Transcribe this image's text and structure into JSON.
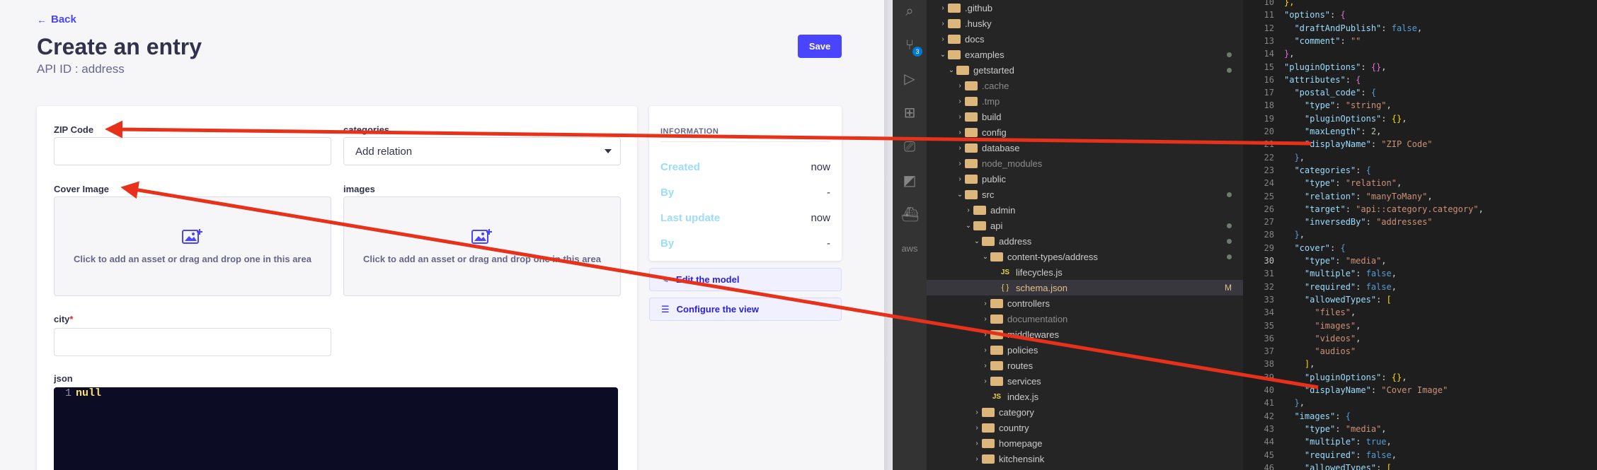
{
  "strapi": {
    "back_label": "Back",
    "title": "Create an entry",
    "api_id": "API ID : address",
    "save_label": "Save",
    "fields": {
      "zip_label": "ZIP Code",
      "categories_label": "categories",
      "categories_placeholder": "Add relation",
      "cover_label": "Cover Image",
      "images_label": "images",
      "dropzone_text": "Click to add an asset or drag and drop one in this area",
      "city_label": "city",
      "city_required_mark": "*",
      "json_label": "json",
      "json_line_number": "1",
      "json_value": "null"
    },
    "information": {
      "title": "INFORMATION",
      "rows": [
        {
          "key": "Created",
          "value": "now"
        },
        {
          "key": "By",
          "value": "-"
        },
        {
          "key": "Last update",
          "value": "now"
        },
        {
          "key": "By",
          "value": "-"
        }
      ]
    },
    "edit_model_label": "Edit the model",
    "configure_view_label": "Configure the view",
    "accent_color": "#4945ff"
  },
  "vscode": {
    "source_control_badge": "3",
    "explorer": [
      {
        "label": ".github",
        "type": "folder",
        "open": false,
        "depth": 0
      },
      {
        "label": ".husky",
        "type": "folder",
        "open": false,
        "depth": 0
      },
      {
        "label": "docs",
        "type": "folder",
        "open": false,
        "depth": 0
      },
      {
        "label": "examples",
        "type": "folder",
        "open": true,
        "depth": 0,
        "dot": true
      },
      {
        "label": "getstarted",
        "type": "folder",
        "open": true,
        "depth": 1,
        "dot": true
      },
      {
        "label": ".cache",
        "type": "folder",
        "open": false,
        "depth": 2,
        "dim": true
      },
      {
        "label": ".tmp",
        "type": "folder",
        "open": false,
        "depth": 2,
        "dim": true
      },
      {
        "label": "build",
        "type": "folder",
        "open": false,
        "depth": 2
      },
      {
        "label": "config",
        "type": "folder",
        "open": false,
        "depth": 2
      },
      {
        "label": "database",
        "type": "folder",
        "open": false,
        "depth": 2
      },
      {
        "label": "node_modules",
        "type": "folder",
        "open": false,
        "depth": 2,
        "dim": true
      },
      {
        "label": "public",
        "type": "folder",
        "open": false,
        "depth": 2
      },
      {
        "label": "src",
        "type": "folder",
        "open": true,
        "depth": 2,
        "dot": true
      },
      {
        "label": "admin",
        "type": "folder",
        "open": false,
        "depth": 3
      },
      {
        "label": "api",
        "type": "folder",
        "open": true,
        "depth": 3,
        "dot": true
      },
      {
        "label": "address",
        "type": "folder",
        "open": true,
        "depth": 4,
        "dot": true
      },
      {
        "label": "content-types/address",
        "type": "folder",
        "open": true,
        "depth": 5,
        "dot": true
      },
      {
        "label": "lifecycles.js",
        "type": "js",
        "depth": 6
      },
      {
        "label": "schema.json",
        "type": "json",
        "depth": 6,
        "selected": true,
        "mod": "M"
      },
      {
        "label": "controllers",
        "type": "folder",
        "open": false,
        "depth": 5
      },
      {
        "label": "documentation",
        "type": "folder",
        "open": false,
        "depth": 5,
        "dim": true
      },
      {
        "label": "middlewares",
        "type": "folder",
        "open": false,
        "depth": 5
      },
      {
        "label": "policies",
        "type": "folder",
        "open": false,
        "depth": 5
      },
      {
        "label": "routes",
        "type": "folder",
        "open": false,
        "depth": 5
      },
      {
        "label": "services",
        "type": "folder",
        "open": false,
        "depth": 5
      },
      {
        "label": "index.js",
        "type": "js",
        "depth": 5
      },
      {
        "label": "category",
        "type": "folder",
        "open": false,
        "depth": 4
      },
      {
        "label": "country",
        "type": "folder",
        "open": false,
        "depth": 4
      },
      {
        "label": "homepage",
        "type": "folder",
        "open": false,
        "depth": 4
      },
      {
        "label": "kitchensink",
        "type": "folder",
        "open": false,
        "depth": 4
      }
    ],
    "code_lines": [
      {
        "n": "10",
        "html": "<span class='y'>},</span>"
      },
      {
        "n": "11",
        "html": "<span class='k'>\"options\"</span>: <span class='p'>{</span>"
      },
      {
        "n": "12",
        "html": "  <span class='k'>\"draftAndPublish\"</span>: <span class='b'>false</span>,"
      },
      {
        "n": "13",
        "html": "  <span class='k'>\"comment\"</span>: <span class='s'>\"\"</span>"
      },
      {
        "n": "14",
        "html": "<span class='p'>}</span>,"
      },
      {
        "n": "15",
        "html": "<span class='k'>\"pluginOptions\"</span>: <span class='p'>{}</span>,"
      },
      {
        "n": "16",
        "html": "<span class='k'>\"attributes\"</span>: <span class='p'>{</span>"
      },
      {
        "n": "17",
        "html": "  <span class='k'>\"postal_code\"</span>: <span class='b'>{</span>"
      },
      {
        "n": "18",
        "html": "    <span class='k'>\"type\"</span>: <span class='s'>\"string\"</span>,"
      },
      {
        "n": "19",
        "html": "    <span class='k'>\"pluginOptions\"</span>: <span class='y'>{}</span>,"
      },
      {
        "n": "20",
        "html": "    <span class='k'>\"maxLength\"</span>: <span class='n'>2</span>,"
      },
      {
        "n": "21",
        "html": "    <span class='k'>\"displayName\"</span>: <span class='s'>\"ZIP Code\"</span>"
      },
      {
        "n": "22",
        "html": "  <span class='b'>}</span>,"
      },
      {
        "n": "23",
        "html": "  <span class='k'>\"categories\"</span>: <span class='b'>{</span>"
      },
      {
        "n": "24",
        "html": "    <span class='k'>\"type\"</span>: <span class='s'>\"relation\"</span>,"
      },
      {
        "n": "25",
        "html": "    <span class='k'>\"relation\"</span>: <span class='s'>\"manyToMany\"</span>,"
      },
      {
        "n": "26",
        "html": "    <span class='k'>\"target\"</span>: <span class='s'>\"api::category.category\"</span>,"
      },
      {
        "n": "27",
        "html": "    <span class='k'>\"inversedBy\"</span>: <span class='s'>\"addresses\"</span>"
      },
      {
        "n": "28",
        "html": "  <span class='b'>}</span>,"
      },
      {
        "n": "29",
        "html": "  <span class='k'>\"cover\"</span>: <span class='b'>{</span>"
      },
      {
        "n": "30",
        "html": "    <span class='k'>\"type\"</span>: <span class='s'>\"media\"</span>,",
        "current": true
      },
      {
        "n": "31",
        "html": "    <span class='k'>\"multiple\"</span>: <span class='b'>false</span>,"
      },
      {
        "n": "32",
        "html": "    <span class='k'>\"required\"</span>: <span class='b'>false</span>,"
      },
      {
        "n": "33",
        "html": "    <span class='k'>\"allowedTypes\"</span>: <span class='y'>[</span>"
      },
      {
        "n": "34",
        "html": "      <span class='s'>\"files\"</span>,"
      },
      {
        "n": "35",
        "html": "      <span class='s'>\"images\"</span>,"
      },
      {
        "n": "36",
        "html": "      <span class='s'>\"videos\"</span>,"
      },
      {
        "n": "37",
        "html": "      <span class='s'>\"audios\"</span>"
      },
      {
        "n": "38",
        "html": "    <span class='y'>]</span>,"
      },
      {
        "n": "39",
        "html": "    <span class='k'>\"pluginOptions\"</span>: <span class='y'>{}</span>,"
      },
      {
        "n": "40",
        "html": "    <span class='k'>\"displayName\"</span>: <span class='s'>\"Cover Image\"</span>"
      },
      {
        "n": "41",
        "html": "  <span class='b'>}</span>,"
      },
      {
        "n": "42",
        "html": "  <span class='k'>\"images\"</span>: <span class='b'>{</span>"
      },
      {
        "n": "43",
        "html": "    <span class='k'>\"type\"</span>: <span class='s'>\"media\"</span>,"
      },
      {
        "n": "44",
        "html": "    <span class='k'>\"multiple\"</span>: <span class='b'>true</span>,"
      },
      {
        "n": "45",
        "html": "    <span class='k'>\"required\"</span>: <span class='b'>false</span>,"
      },
      {
        "n": "46",
        "html": "    <span class='k'>\"allowedTypes\"</span>: <span class='y'>[</span>"
      }
    ]
  },
  "annotation_color": "#e8311a"
}
